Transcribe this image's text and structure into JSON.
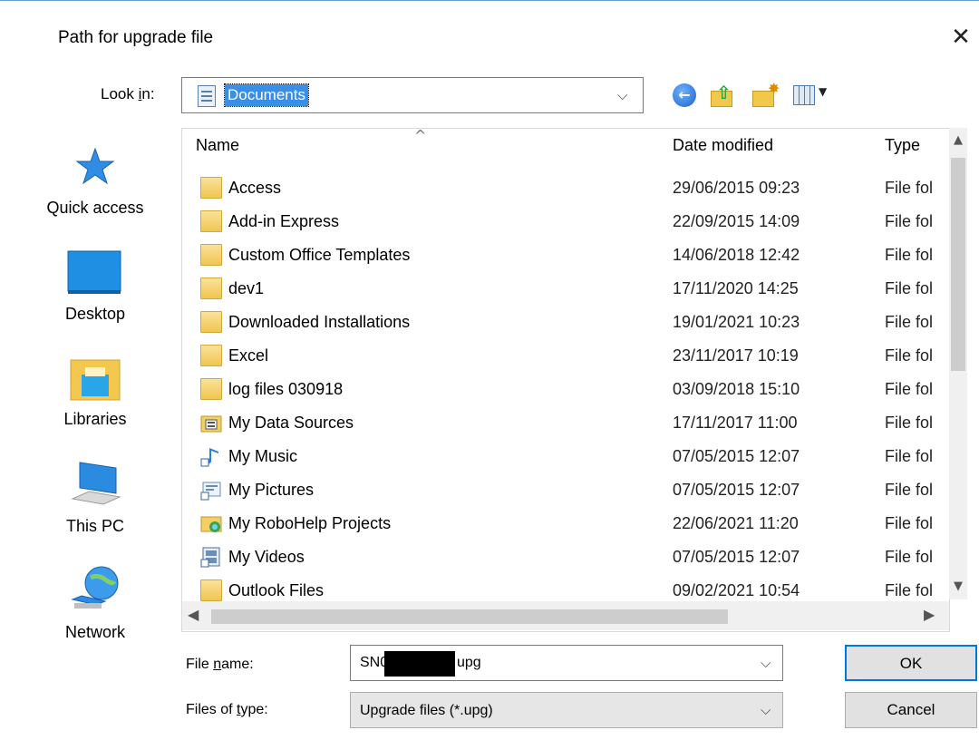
{
  "dialog": {
    "title": "Path for upgrade file",
    "close_glyph": "✕"
  },
  "lookin": {
    "label_prefix": "Look ",
    "label_accel": "i",
    "label_suffix": "n:",
    "value": "Documents"
  },
  "toolbar": {
    "back_icon": "back-icon",
    "up_icon": "up-folder-icon",
    "new_icon": "new-folder-icon",
    "view_icon": "view-menu-icon"
  },
  "places": [
    {
      "label": "Quick access",
      "icon": "star-icon"
    },
    {
      "label": "Desktop",
      "icon": "desktop-icon"
    },
    {
      "label": "Libraries",
      "icon": "libraries-icon"
    },
    {
      "label": "This PC",
      "icon": "computer-icon"
    },
    {
      "label": "Network",
      "icon": "network-icon"
    }
  ],
  "columns": {
    "name": "Name",
    "date": "Date modified",
    "type": "Type"
  },
  "files": [
    {
      "name": "Access",
      "date": "29/06/2015 09:23",
      "type": "File fol",
      "icon": "folder"
    },
    {
      "name": "Add-in Express",
      "date": "22/09/2015 14:09",
      "type": "File fol",
      "icon": "folder"
    },
    {
      "name": "Custom Office Templates",
      "date": "14/06/2018 12:42",
      "type": "File fol",
      "icon": "folder"
    },
    {
      "name": "dev1",
      "date": "17/11/2020 14:25",
      "type": "File fol",
      "icon": "folder"
    },
    {
      "name": "Downloaded Installations",
      "date": "19/01/2021 10:23",
      "type": "File fol",
      "icon": "folder"
    },
    {
      "name": "Excel",
      "date": "23/11/2017 10:19",
      "type": "File fol",
      "icon": "folder"
    },
    {
      "name": "log files 030918",
      "date": "03/09/2018 15:10",
      "type": "File fol",
      "icon": "folder"
    },
    {
      "name": "My Data Sources",
      "date": "17/11/2017 11:00",
      "type": "File fol",
      "icon": "data-sources"
    },
    {
      "name": "My Music",
      "date": "07/05/2015 12:07",
      "type": "File fol",
      "icon": "music"
    },
    {
      "name": "My Pictures",
      "date": "07/05/2015 12:07",
      "type": "File fol",
      "icon": "pictures"
    },
    {
      "name": "My RoboHelp Projects",
      "date": "22/06/2021 11:20",
      "type": "File fol",
      "icon": "robohelp"
    },
    {
      "name": "My Videos",
      "date": "07/05/2015 12:07",
      "type": "File fol",
      "icon": "videos"
    },
    {
      "name": "Outlook Files",
      "date": "09/02/2021 10:54",
      "type": "File fol",
      "icon": "folder"
    }
  ],
  "filename": {
    "label_prefix": "File ",
    "label_accel": "n",
    "label_suffix": "ame:",
    "value_start": "SN0",
    "value_end": "upg"
  },
  "filetype": {
    "label_prefix": "Files of ",
    "label_accel": "t",
    "label_suffix": "ype:",
    "value": "Upgrade files (*.upg)"
  },
  "buttons": {
    "ok": "OK",
    "cancel": "Cancel"
  }
}
